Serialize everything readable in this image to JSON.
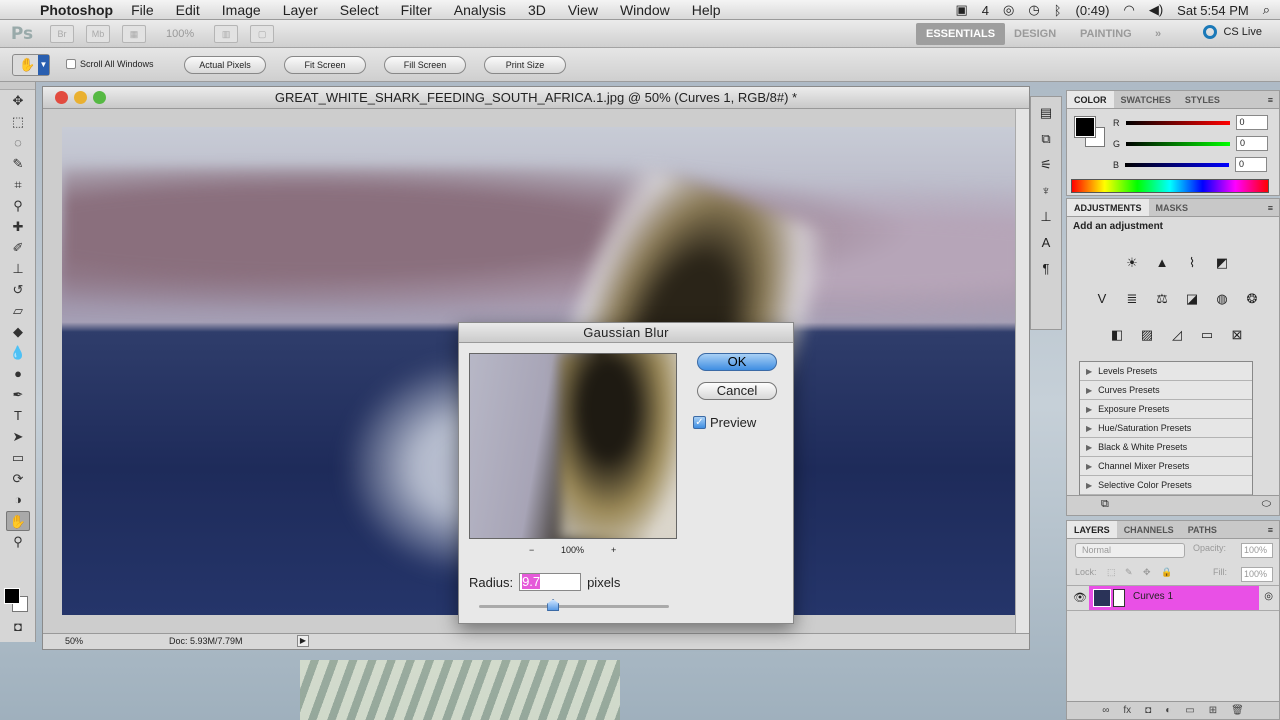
{
  "menubar": {
    "app_name": "Photoshop",
    "menus": [
      "File",
      "Edit",
      "Image",
      "Layer",
      "Select",
      "Filter",
      "Analysis",
      "3D",
      "View",
      "Window",
      "Help"
    ],
    "status_num": "4",
    "battery": "(0:49)",
    "clock": "Sat 5:54 PM"
  },
  "appbar": {
    "logo": "Ps",
    "zoom": "100%",
    "workspaces": [
      "ESSENTIALS",
      "DESIGN",
      "PAINTING"
    ],
    "more": "»",
    "cs_live": "CS Live"
  },
  "options": {
    "scroll_all": "Scroll All Windows",
    "actual_pixels": "Actual Pixels",
    "fit_screen": "Fit Screen",
    "fill_screen": "Fill Screen",
    "print_size": "Print Size"
  },
  "document": {
    "title": "GREAT_WHITE_SHARK_FEEDING_SOUTH_AFRICA.1.jpg @ 50% (Curves 1, RGB/8#) *",
    "zoom": "50%",
    "doc_info": "Doc: 5.93M/7.79M"
  },
  "dialog": {
    "title": "Gaussian Blur",
    "ok": "OK",
    "cancel": "Cancel",
    "preview_label": "Preview",
    "preview_zoom": "100%",
    "zoom_minus": "−",
    "zoom_plus": "+",
    "radius_label": "Radius:",
    "radius_value": "9.7",
    "radius_unit": "pixels",
    "radius_slider_fraction": 0.39
  },
  "color_panel": {
    "tabs": [
      "COLOR",
      "SWATCHES",
      "STYLES"
    ],
    "channels": [
      {
        "label": "R",
        "value": "0"
      },
      {
        "label": "G",
        "value": "0"
      },
      {
        "label": "B",
        "value": "0"
      }
    ]
  },
  "adjustments_panel": {
    "tabs": [
      "ADJUSTMENTS",
      "MASKS"
    ],
    "heading": "Add an adjustment",
    "presets": [
      "Levels Presets",
      "Curves Presets",
      "Exposure Presets",
      "Hue/Saturation Presets",
      "Black & White Presets",
      "Channel Mixer Presets",
      "Selective Color Presets"
    ]
  },
  "layers_panel": {
    "tabs": [
      "LAYERS",
      "CHANNELS",
      "PATHS"
    ],
    "blend_mode": "Normal",
    "opacity_label": "Opacity:",
    "opacity_value": "100%",
    "lock_label": "Lock:",
    "fill_label": "Fill:",
    "fill_value": "100%",
    "layer_name": "Curves 1"
  },
  "colors": {
    "accent_blue": "#3f8ee2",
    "layer_highlight": "#e950e6"
  }
}
